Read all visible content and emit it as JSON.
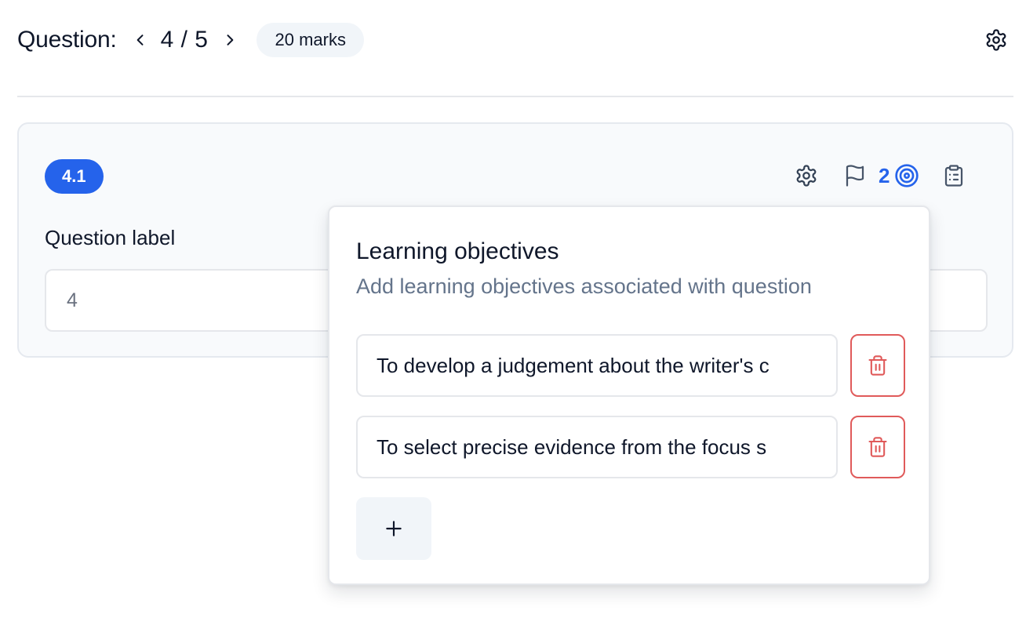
{
  "header": {
    "title": "Question:",
    "counter": "4 / 5",
    "marks": "20 marks"
  },
  "card": {
    "badge": "4.1",
    "objectives_count": "2",
    "label": "Question label",
    "label_value": "4"
  },
  "popover": {
    "title": "Learning objectives",
    "subtitle": "Add learning objectives associated with question",
    "objectives": [
      {
        "value": "To develop a judgement about the writer's c"
      },
      {
        "value": "To select precise evidence from the focus s"
      }
    ],
    "add_label": "+"
  },
  "colors": {
    "accent": "#2563eb",
    "danger": "#e05a5a",
    "muted": "#64748b"
  },
  "icons": {
    "prev": "chevron-left-icon",
    "next": "chevron-right-icon",
    "settings": "gear-icon",
    "flag": "flag-icon",
    "target": "target-icon",
    "clipboard": "clipboard-list-icon",
    "trash": "trash-icon",
    "add": "plus-icon"
  }
}
